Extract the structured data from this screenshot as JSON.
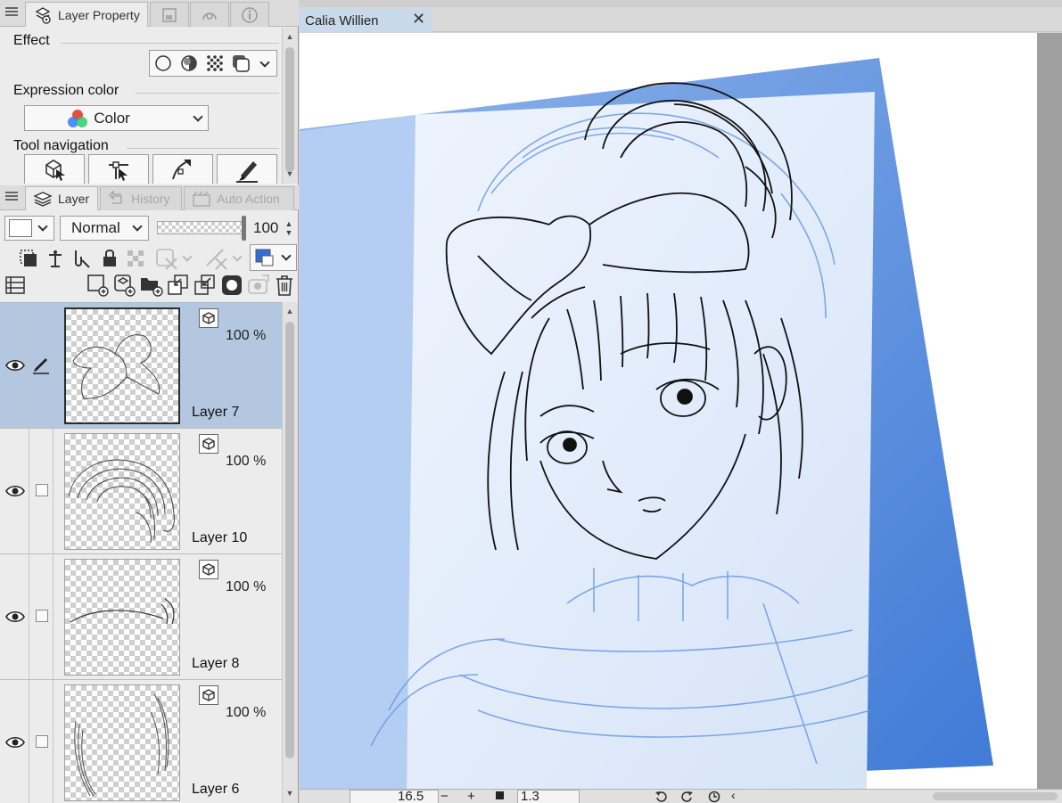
{
  "property_panel": {
    "tabs": [
      {
        "label": "Layer Property"
      }
    ],
    "effect_label": "Effect",
    "expression_color_label": "Expression color",
    "expression_color_value": "Color",
    "tool_navigation_label": "Tool navigation"
  },
  "layer_panel": {
    "tabs": [
      {
        "label": "Layer"
      },
      {
        "label": "History"
      },
      {
        "label": "Auto Action"
      }
    ],
    "blend_mode": "Normal",
    "opacity_value": "100",
    "layers": [
      {
        "name": "Layer 7",
        "opacity": "100 %",
        "selected": true
      },
      {
        "name": "Layer 10",
        "opacity": "100 %",
        "selected": false
      },
      {
        "name": "Layer 8",
        "opacity": "100 %",
        "selected": false
      },
      {
        "name": "Layer 6",
        "opacity": "100 %",
        "selected": false
      }
    ]
  },
  "document": {
    "tab_title": "Calia Willien"
  },
  "status_bar": {
    "zoom": "16.5",
    "minus": "−",
    "plus": "+",
    "angle": "1.3"
  },
  "colors": {
    "selection": "#b3c7e0",
    "doc_tab": "#c9d9ec",
    "drawing_color": "#2f6fd6",
    "sketch_blue": "#3d82e0"
  }
}
